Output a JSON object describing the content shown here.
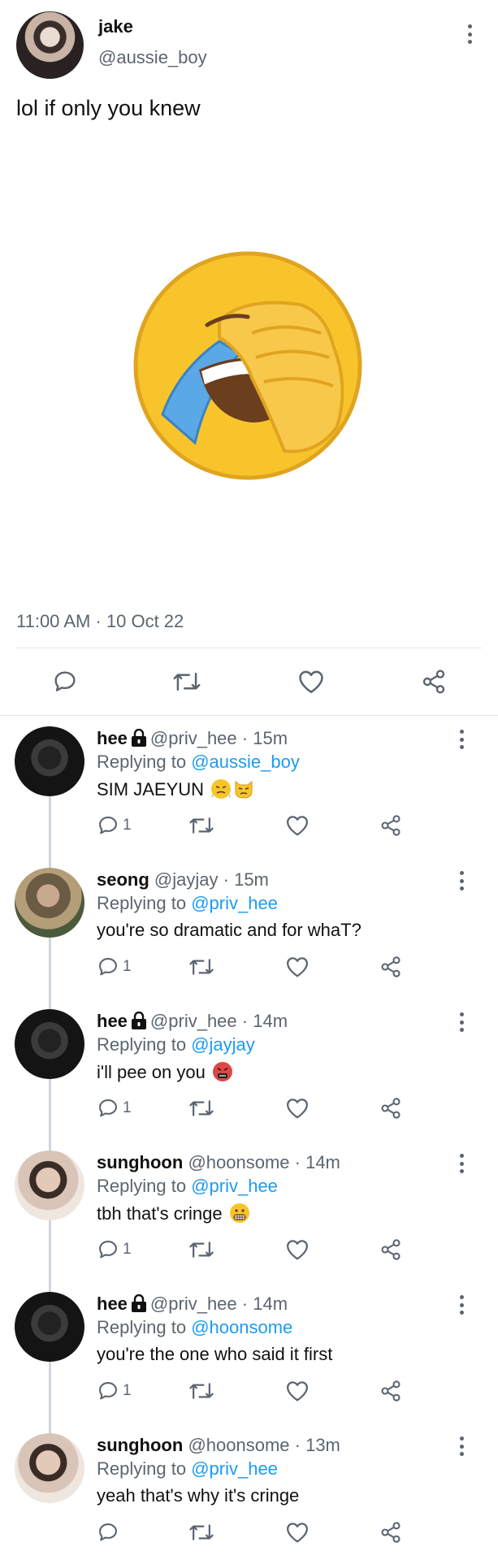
{
  "tweet": {
    "author_name": "jake",
    "author_handle": "@aussie_boy",
    "text": "lol if only you knew",
    "image_icon": "facepalm-laughing-emoji",
    "timestamp": "11:00 AM · 10 Oct 22"
  },
  "icons": {
    "reply": "reply-icon",
    "retweet": "retweet-icon",
    "like": "like-icon",
    "share": "share-icon",
    "more": "more-vertical-icon",
    "lock": "lock-icon"
  },
  "colors": {
    "text": "#111111",
    "muted": "#5b6570",
    "link": "#1d9bf0",
    "divider": "#e3e7eb"
  },
  "replies": [
    {
      "name": "hee",
      "locked": true,
      "handle": "@priv_hee",
      "time": "· 15m",
      "replying_prefix": "Replying to ",
      "replying_to": "@aussie_boy",
      "text": "SIM JAEYUN",
      "emojis": [
        "huffing-face-emoji",
        "angry-cat-emoji"
      ],
      "reply_count": "1"
    },
    {
      "name": "seong",
      "locked": false,
      "handle": "@jayjay",
      "time": "· 15m",
      "replying_prefix": "Replying to ",
      "replying_to": "@priv_hee",
      "text": "you're so dramatic and for whaT?",
      "emojis": [],
      "reply_count": "1"
    },
    {
      "name": "hee",
      "locked": true,
      "handle": "@priv_hee",
      "time": "· 14m",
      "replying_prefix": "Replying to ",
      "replying_to": "@jayjay",
      "text": "i'll pee on you",
      "emojis": [
        "cursing-face-emoji"
      ],
      "reply_count": "1"
    },
    {
      "name": "sunghoon",
      "locked": false,
      "handle": "@hoonsome",
      "time": "· 14m",
      "replying_prefix": "Replying to ",
      "replying_to": "@priv_hee",
      "text": "tbh that's cringe",
      "emojis": [
        "grimacing-face-emoji"
      ],
      "reply_count": "1"
    },
    {
      "name": "hee",
      "locked": true,
      "handle": "@priv_hee",
      "time": "· 14m",
      "replying_prefix": "Replying to ",
      "replying_to": "@hoonsome",
      "text": "you're the one who said it first",
      "emojis": [],
      "reply_count": "1"
    },
    {
      "name": "sunghoon",
      "locked": false,
      "handle": "@hoonsome",
      "time": "· 13m",
      "replying_prefix": "Replying to ",
      "replying_to": "@priv_hee",
      "text": "yeah that's why it's cringe",
      "emojis": [],
      "reply_count": ""
    }
  ]
}
